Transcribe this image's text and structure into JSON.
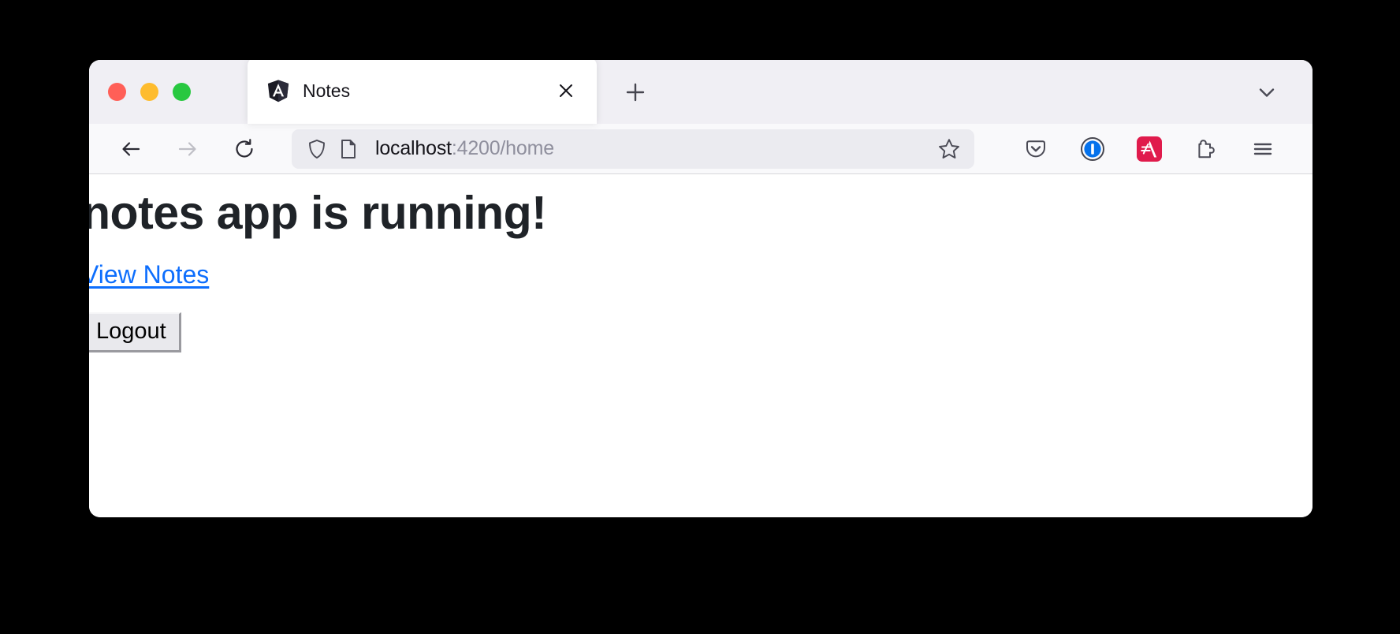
{
  "window": {
    "traffic_lights": [
      {
        "name": "close",
        "color": "#ff5f57"
      },
      {
        "name": "minimize",
        "color": "#febc2e"
      },
      {
        "name": "maximize",
        "color": "#28c840"
      }
    ]
  },
  "tabs": {
    "items": [
      {
        "title": "Notes",
        "favicon": "angular-icon",
        "close_label": "×"
      }
    ],
    "new_tab_label": "+",
    "list_all_tabs_icon": "chevron-down-icon"
  },
  "toolbar": {
    "back_icon": "arrow-left-icon",
    "forward_icon": "arrow-right-icon",
    "reload_icon": "reload-icon",
    "shield_icon": "shield-icon",
    "page_icon": "page-icon",
    "bookmark_icon": "star-icon",
    "extensions": [
      {
        "name": "pocket-icon",
        "color": "#5b5b66"
      },
      {
        "name": "1password-icon",
        "color": "#0572ec"
      },
      {
        "name": "wolfram-alpha-icon",
        "color": "#e01b4c"
      },
      {
        "name": "extensions-puzzle-icon",
        "color": "#5b5b66"
      },
      {
        "name": "app-menu-icon",
        "color": "#5b5b66"
      }
    ]
  },
  "url": {
    "host": "localhost",
    "path": ":4200/home",
    "full": "localhost:4200/home"
  },
  "page": {
    "heading": "notes app is running!",
    "link_label": "View Notes",
    "link_color": "#0d6efd",
    "button_label": "Logout"
  }
}
